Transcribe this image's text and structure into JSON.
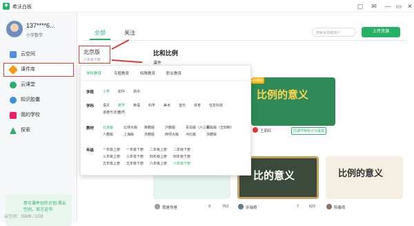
{
  "app": {
    "title": "希沃白板",
    "logo_glyph": "✚"
  },
  "window_controls": [
    "▢",
    "✉",
    "—",
    "▭",
    "✕"
  ],
  "user": {
    "name": "137****6...",
    "role": "小学数学"
  },
  "nav": [
    {
      "label": "云空间",
      "icon": "cloud-icon",
      "color": "#4a90e2"
    },
    {
      "label": "课件库",
      "icon": "courseware-icon",
      "color": "#f39c12"
    },
    {
      "label": "云课堂",
      "icon": "cloud-class-icon",
      "color": "#27b068"
    },
    {
      "label": "知识胶囊",
      "icon": "capsule-icon",
      "color": "#3d8fe0"
    },
    {
      "label": "我的学校",
      "icon": "school-icon",
      "color": "#e91e63"
    },
    {
      "label": "探索",
      "icon": "rocket-icon",
      "color": "#27b068"
    }
  ],
  "storage": "云空间：35MB / 2GB",
  "banner": {
    "text": "参与课件创作计划\n得云空间、官方证书"
  },
  "tabs": {
    "all": "全部",
    "follow": "关注"
  },
  "search": {
    "placeholder": "搜索资源或用户"
  },
  "upload": "上传资源",
  "version": {
    "name": "北京版",
    "grade": "六年级下册"
  },
  "section": {
    "title": "比和比例",
    "sub": "课件"
  },
  "popup": {
    "tabs": [
      "学科教育",
      "专题教育",
      "特殊教育",
      "职业教育"
    ],
    "stage": {
      "label": "学段",
      "options": [
        "小学",
        "初中",
        "高中"
      ],
      "selected": 0
    },
    "subject": {
      "label": "学科",
      "options": [
        "语文",
        "数学",
        "英语",
        "科学",
        "美术",
        "音乐",
        "体育",
        "信息科技",
        "道德与法治",
        "自然"
      ],
      "selected": 1
    },
    "material": {
      "label": "教材",
      "options": [
        "北京版",
        "北师大版",
        "冀教版",
        "沪教版",
        "青岛版（六三制）",
        "青岛版（五四制）",
        "人教版",
        "上海版",
        "苏教版",
        "西师大版",
        "河北版",
        "浙教版"
      ],
      "selected": 0
    },
    "grade": {
      "label": "年级",
      "options": [
        "一年级上册",
        "一年级下册",
        "二年级上册",
        "二年级下册",
        "三年级上册",
        "三年级下册",
        "四年级上册",
        "四年级下册",
        "五年级上册",
        "五年级下册",
        "六年级上册",
        "六年级下册"
      ],
      "selected": 11
    }
  },
  "cards": [
    {
      "title": "比例的意义",
      "tag": "微课版",
      "author": "王丽红",
      "badge": "同课节特色计分最高"
    },
    {
      "title": "比的意义"
    },
    {
      "title": "比例的意义"
    }
  ],
  "bottom": [
    {
      "author": "我是你爸",
      "likes": "9",
      "views": "753"
    },
    {
      "author": "许瑞奇",
      "likes": "7",
      "views": "622"
    },
    {
      "author": "阳春雨",
      "likes": "",
      "views": ""
    }
  ]
}
